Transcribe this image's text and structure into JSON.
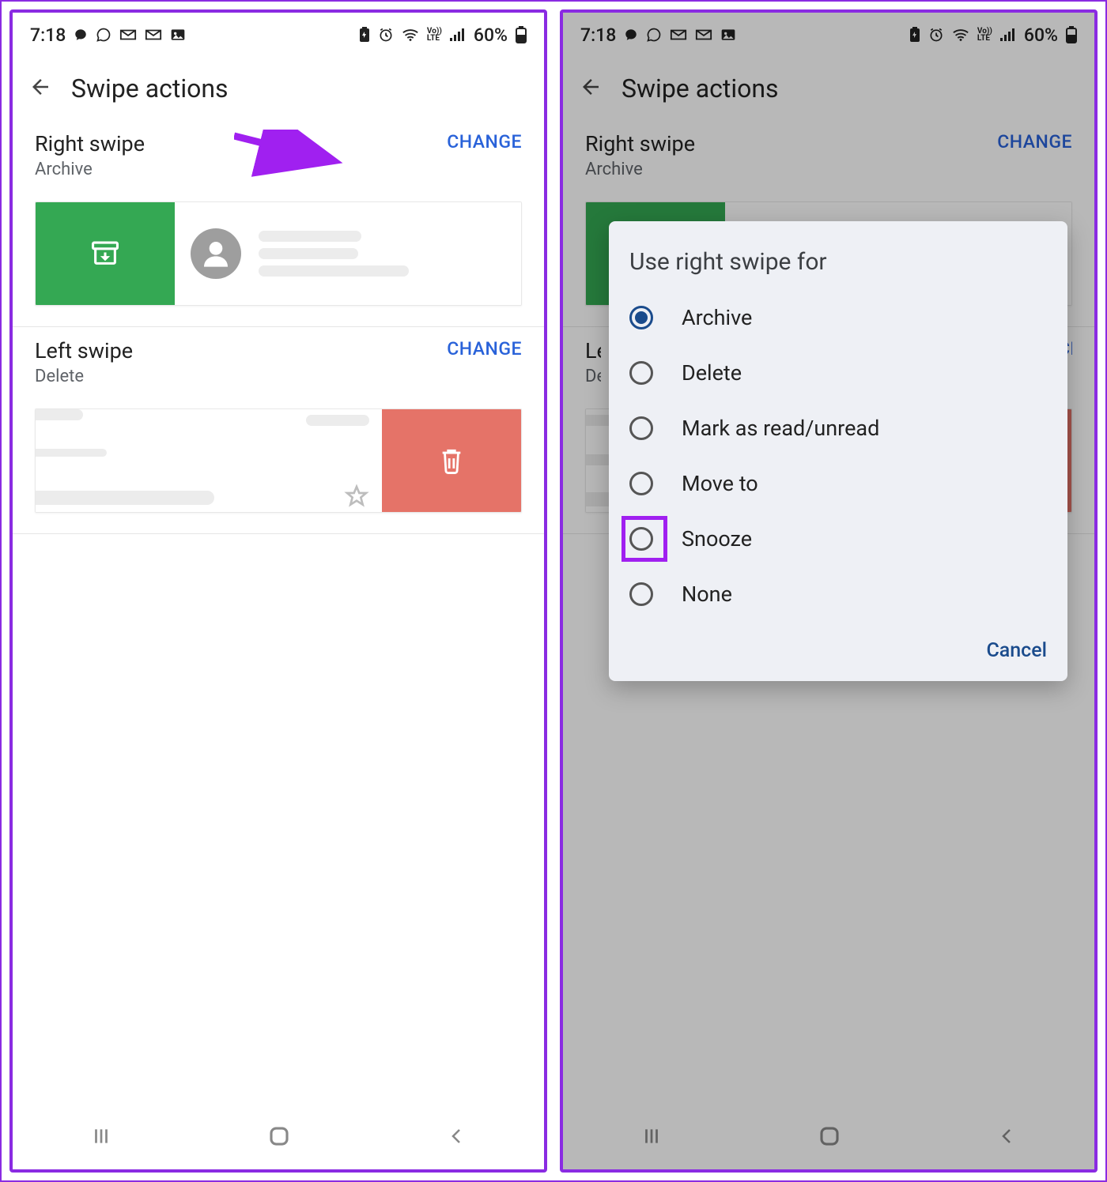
{
  "status": {
    "time": "7:18",
    "battery": "60%"
  },
  "header": {
    "title": "Swipe actions"
  },
  "right_swipe": {
    "title": "Right swipe",
    "subtitle": "Archive",
    "change": "CHANGE"
  },
  "left_swipe": {
    "title": "Left swipe",
    "subtitle": "Delete",
    "change": "CHANGE"
  },
  "dialog": {
    "title": "Use right swipe for",
    "options": [
      "Archive",
      "Delete",
      "Mark as read/unread",
      "Move to",
      "Snooze",
      "None"
    ],
    "selected_index": 0,
    "highlighted_index": 4,
    "cancel": "Cancel"
  }
}
